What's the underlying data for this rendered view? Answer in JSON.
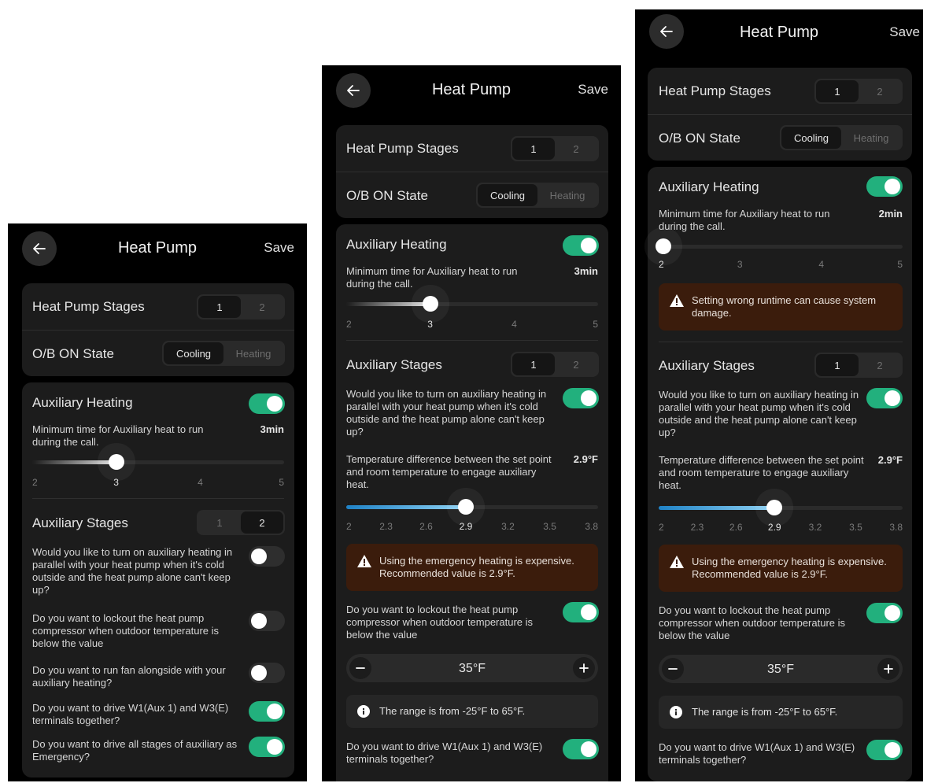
{
  "header": {
    "title": "Heat Pump",
    "save_label": "Save"
  },
  "labels": {
    "hp_stages": "Heat Pump Stages",
    "ob_state": "O/B ON State",
    "aux_heating": "Auxiliary Heating",
    "aux_min_time": "Minimum time for Auxiliary heat to run during the call.",
    "aux_stages": "Auxiliary Stages",
    "parallel_q": "Would you like to turn on auxiliary heating in parallel with your heat pump when it's cold outside and the heat pump alone can't keep up?",
    "temp_diff": "Temperature difference between the set point and room temperature to engage auxiliary heat.",
    "lockout_q": "Do you want to lockout the heat pump compressor when outdoor temperature is below the value",
    "fan_q": "Do you want to run fan alongside with your auxiliary heating?",
    "drive_q": "Do you want to drive W1(Aux 1) and W3(E) terminals together?",
    "emergency_q": "Do you want to drive all stages of auxiliary as Emergency?"
  },
  "options": {
    "stages": [
      "1",
      "2"
    ],
    "ob": [
      "Cooling",
      "Heating"
    ],
    "runtime_ticks": [
      "2",
      "3",
      "4",
      "5"
    ],
    "temp_ticks": [
      "2",
      "2.3",
      "2.6",
      "2.9",
      "3.2",
      "3.5",
      "3.8"
    ]
  },
  "messages": {
    "runtime_warning": "Setting wrong runtime can cause system damage.",
    "emergency_warning": "Using the emergency heating is expensive. Recommended value is 2.9°F.",
    "range_info": "The range is from -25°F to 65°F."
  },
  "screens": [
    {
      "hp_stage": "1",
      "ob_state": "Cooling",
      "aux_heating": true,
      "runtime_value": "3min",
      "runtime_level": 0.333,
      "aux_stage": "2",
      "parallel": false,
      "lockout": false,
      "fan": false,
      "drive_w1_w3": true,
      "emergency": true
    },
    {
      "hp_stage": "1",
      "ob_state": "Cooling",
      "aux_heating": true,
      "runtime_value": "3min",
      "runtime_level": 0.333,
      "aux_stage": "1",
      "parallel": true,
      "temp_diff_value": "2.9°F",
      "temp_diff_level": 0.5,
      "lockout": true,
      "lockout_temp": "35°F",
      "drive_w1_w3": true
    },
    {
      "hp_stage": "1",
      "ob_state": "Cooling",
      "aux_heating": true,
      "runtime_value": "2min",
      "runtime_level": 0,
      "aux_stage": "1",
      "parallel": true,
      "temp_diff_value": "2.9°F",
      "temp_diff_level": 0.5,
      "lockout": true,
      "lockout_temp": "35°F",
      "drive_w1_w3": true
    }
  ]
}
